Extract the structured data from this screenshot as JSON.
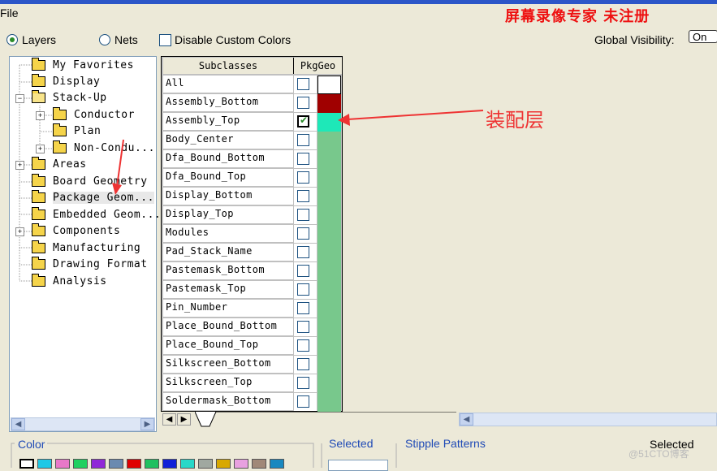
{
  "menubar": {
    "file": "File",
    "watermark": "屏幕录像专家 未注册"
  },
  "toolbar": {
    "layers": "Layers",
    "nets": "Nets",
    "disable_custom": "Disable Custom Colors",
    "global_visibility": "Global Visibility:",
    "on": "On"
  },
  "tree": {
    "items": [
      {
        "label": "My Favorites"
      },
      {
        "label": "Display"
      },
      {
        "label": "Stack-Up"
      },
      {
        "label": "Conductor"
      },
      {
        "label": "Plan"
      },
      {
        "label": "Non-Condu..."
      },
      {
        "label": "Areas"
      },
      {
        "label": "Board Geometry"
      },
      {
        "label": "Package Geom..."
      },
      {
        "label": "Embedded Geom..."
      },
      {
        "label": "Components"
      },
      {
        "label": "Manufacturing"
      },
      {
        "label": "Drawing Format"
      },
      {
        "label": "Analysis"
      }
    ]
  },
  "grid": {
    "col_subclasses": "Subclasses",
    "col_pkggeo": "PkgGeo",
    "rows": [
      {
        "name": "All",
        "checked": false,
        "color": "#ffffff"
      },
      {
        "name": "Assembly_Bottom",
        "checked": false,
        "color": "#a00000"
      },
      {
        "name": "Assembly_Top",
        "checked": true,
        "color": "#1ee8b8"
      },
      {
        "name": "Body_Center",
        "checked": false,
        "color": "#78c88c"
      },
      {
        "name": "Dfa_Bound_Bottom",
        "checked": false,
        "color": "#78c88c"
      },
      {
        "name": "Dfa_Bound_Top",
        "checked": false,
        "color": "#78c88c"
      },
      {
        "name": "Display_Bottom",
        "checked": false,
        "color": "#78c88c"
      },
      {
        "name": "Display_Top",
        "checked": false,
        "color": "#78c88c"
      },
      {
        "name": "Modules",
        "checked": false,
        "color": "#78c88c"
      },
      {
        "name": "Pad_Stack_Name",
        "checked": false,
        "color": "#78c88c"
      },
      {
        "name": "Pastemask_Bottom",
        "checked": false,
        "color": "#78c88c"
      },
      {
        "name": "Pastemask_Top",
        "checked": false,
        "color": "#78c88c"
      },
      {
        "name": "Pin_Number",
        "checked": false,
        "color": "#78c88c"
      },
      {
        "name": "Place_Bound_Bottom",
        "checked": false,
        "color": "#78c88c"
      },
      {
        "name": "Place_Bound_Top",
        "checked": false,
        "color": "#78c88c"
      },
      {
        "name": "Silkscreen_Bottom",
        "checked": false,
        "color": "#78c88c"
      },
      {
        "name": "Silkscreen_Top",
        "checked": false,
        "color": "#78c88c"
      },
      {
        "name": "Soldermask_Bottom",
        "checked": false,
        "color": "#78c88c"
      }
    ]
  },
  "annotation": {
    "callout": "装配层",
    "color": "#e33333"
  },
  "bottom": {
    "color": "Color",
    "selected": "Selected",
    "stipple": "Stipple Patterns",
    "selected_right": "Selected",
    "watermark": "@51CTO博客",
    "palette": [
      "#ffffff",
      "#1ec8e6",
      "#e878c8",
      "#20d060",
      "#9028d8",
      "#6a8ab0",
      "#e00000",
      "#20c060",
      "#1020d8",
      "#28d8c8",
      "#a0a8a0",
      "#d8a800",
      "#e8a0e0",
      "#a08878",
      "#1888c0"
    ]
  }
}
